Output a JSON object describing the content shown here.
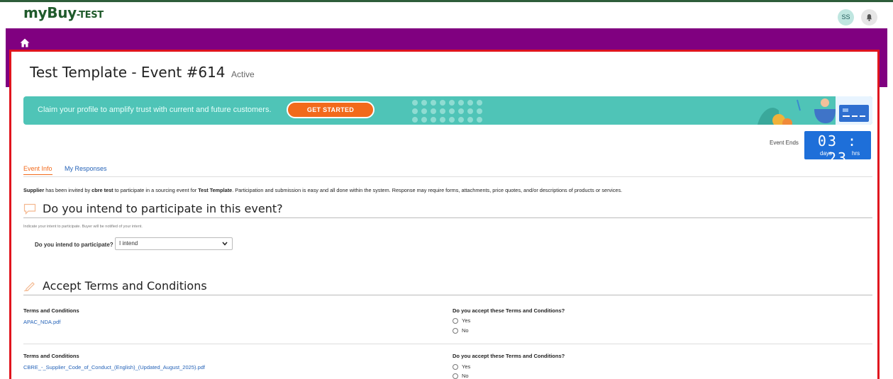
{
  "header": {
    "logo_main": "myBuy",
    "logo_suffix": "-TEST",
    "avatar_initials": "SS"
  },
  "page": {
    "title": "Test Template - Event #614",
    "status": "Active"
  },
  "banner": {
    "text": "Claim your profile to amplify trust with current and future customers.",
    "cta_label": "GET STARTED"
  },
  "countdown": {
    "label": "Event Ends",
    "digits": "03 : 23",
    "days_label": "days",
    "hrs_label": "hrs"
  },
  "tabs": [
    {
      "label": "Event Info",
      "active": true
    },
    {
      "label": "My Responses",
      "active": false
    }
  ],
  "intro": {
    "supplier": "Supplier",
    "part1": " has been invited by ",
    "buyer": "cbre test",
    "part2": " to participate in a sourcing event for ",
    "template": "Test Template",
    "part3": ". Participation and submission is easy and all done within the system. Response may require forms, attachments, price quotes, and/or descriptions of products or services."
  },
  "intent_section": {
    "title": "Do you intend to participate in this event?",
    "hint": "Indicate your intent to participate. Buyer will be notified of your intent.",
    "question": "Do you intend to participate?",
    "selected": "I intend"
  },
  "terms_section": {
    "title": "Accept Terms and Conditions",
    "items": [
      {
        "heading": "Terms and Conditions",
        "file": "APAC_NDA.pdf",
        "question": "Do you accept these Terms and Conditions?",
        "yes": "Yes",
        "no": "No"
      },
      {
        "heading": "Terms and Conditions",
        "file": "CBRE_-_Supplier_Code_of_Conduct_(English)_(Updated_August_2025).pdf",
        "question": "Do you accept these Terms and Conditions?",
        "yes": "Yes",
        "no": "No"
      }
    ]
  },
  "colors": {
    "nav_purple": "#800080",
    "brand_green": "#1f5a2b",
    "banner_teal": "#4fc4b7",
    "cta_orange": "#f26a1b",
    "timer_blue": "#1e6fd9",
    "frame_red": "#e0141e",
    "link_blue": "#2563b8"
  }
}
